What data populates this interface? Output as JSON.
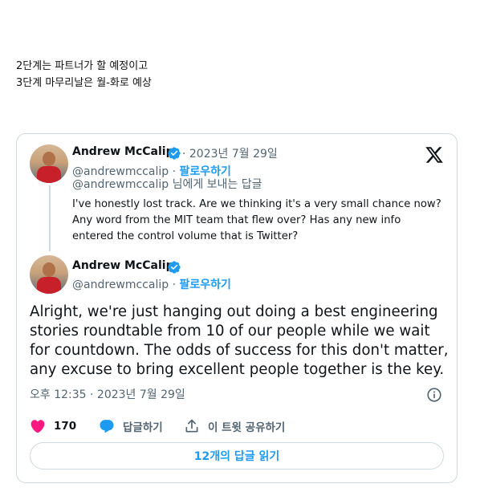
{
  "intro": {
    "line1": "2단계는 파트너가 할 예정이고",
    "line2": "3단계 마무리날은 월-화로 예상"
  },
  "quoted_tweet": {
    "author_name": "Andrew McCalip",
    "date": " · 2023년 7월 29일",
    "handle": "@andrewmccalip",
    "sep": " · ",
    "follow_label": "팔로우하기",
    "reply_to": "@andrewmccalip 님에게 보내는 답글",
    "text": "I've honestly lost track. Are we thinking it's a very small chance now? Any word from the MIT team that flew over? Has any new info entered the control volume that is Twitter?"
  },
  "main_tweet": {
    "author_name": "Andrew McCalip",
    "handle": "@andrewmccalip",
    "sep": " · ",
    "follow_label": "팔로우하기",
    "text": "Alright, we're just hanging out doing a best engineering stories roundtable from 10 of our people while we wait for countdown. The odds of success for this don't matter, any excuse to bring excellent people together is the key.",
    "timestamp": "오후 12:35 · 2023년 7월 29일"
  },
  "actions": {
    "likes": "170",
    "reply_label": "답글하기",
    "share_label": "이 트윗 공유하기"
  },
  "read_replies_label": "12개의 답글 읽기",
  "colors": {
    "accent": "#1d9bf0",
    "like": "#f91880",
    "muted": "#536471",
    "border": "#cfd9de"
  }
}
